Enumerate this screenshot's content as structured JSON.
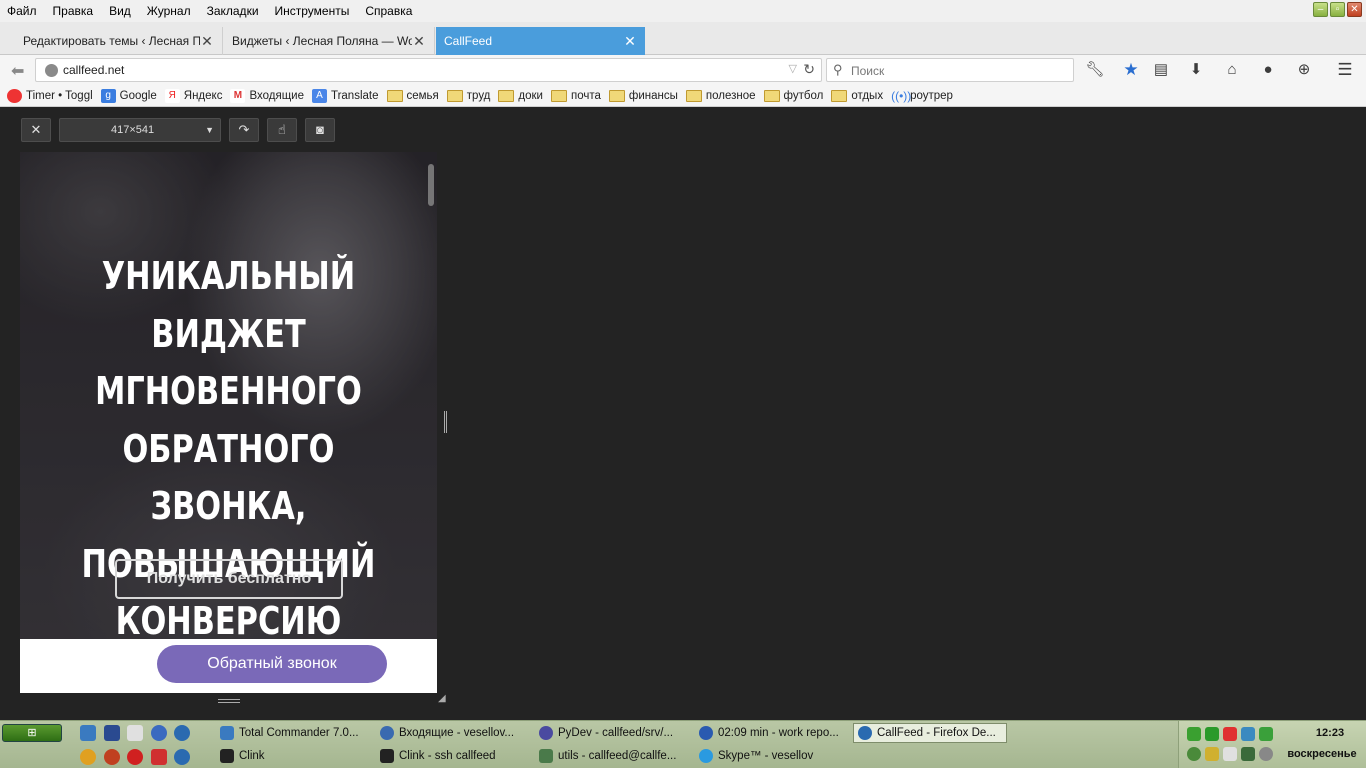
{
  "menu": [
    "Файл",
    "Правка",
    "Вид",
    "Журнал",
    "Закладки",
    "Инструменты",
    "Справка"
  ],
  "tabs": [
    {
      "label": "Редактировать темы ‹ Лесная П..."
    },
    {
      "label": "Виджеты ‹ Лесная Поляна — Wo..."
    },
    {
      "label": "CallFeed"
    }
  ],
  "newtab": "+",
  "url": "callfeed.net",
  "search_placeholder": "Поиск",
  "bookmarks": [
    "Timer • Toggl",
    "Google",
    "Яндекс",
    "Входящие",
    "Translate",
    "семья",
    "труд",
    "доки",
    "почта",
    "финансы",
    "полезное",
    "футбол",
    "отдых",
    "роутрер"
  ],
  "responsive": {
    "size": "417×541"
  },
  "site": {
    "headline": "УНИКАЛЬНЫЙ ВИДЖЕТ МГНОВЕННОГО ОБРАТНОГО ЗВОНКА, ПОВЫШАЮЩИЙ КОНВЕРСИЮ САЙТА",
    "cta": "Получить бесплатно",
    "callback": "Обратный звонок"
  },
  "taskbar": {
    "tasks": [
      "Total Commander 7.0...",
      "Входящие - vesellov...",
      "PyDev - callfeed/srv/...",
      "02:09 min - work repo...",
      "CallFeed - Firefox De...",
      "Clink",
      "Clink  - ssh callfeed",
      "utils - callfeed@callfe...",
      "Skype™ - vesellov"
    ],
    "clock": "12:23",
    "day": "воскресенье"
  },
  "colors": {
    "active_tab": "#4a9ddc",
    "callback_button": "#7a69b8",
    "taskbar": "#b2c29c"
  }
}
